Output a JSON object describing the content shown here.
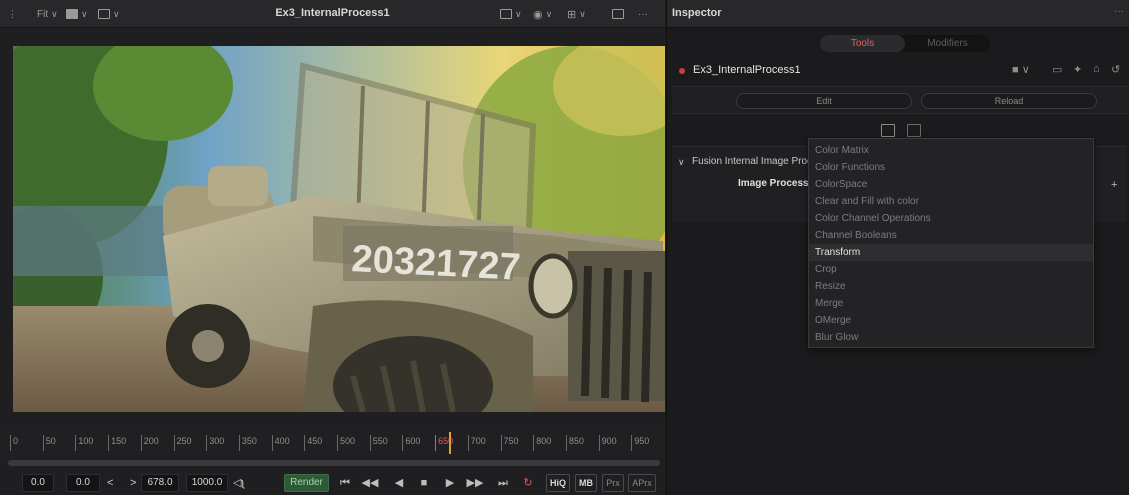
{
  "viewer": {
    "toolbar": {
      "fit_label": "Fit"
    },
    "title": "Ex3_InternalProcess1",
    "plate_number": "20321727",
    "ruler": {
      "ticks": [
        "0",
        "50",
        "100",
        "150",
        "200",
        "250",
        "300",
        "350",
        "400",
        "450",
        "500",
        "550",
        "600",
        "650",
        "700",
        "750",
        "800",
        "850",
        "900",
        "950"
      ]
    },
    "transport": {
      "start": "0.0",
      "current": "0.0",
      "prev": "<",
      "next": ">",
      "end": "678.0",
      "global_end": "1000.0",
      "render_label": "Render",
      "tags": [
        "HiQ",
        "MB",
        "Prx",
        "APrx"
      ]
    }
  },
  "inspector": {
    "title": "Inspector",
    "more": "···",
    "tabs": {
      "tools": "Tools",
      "modifiers": "Modifiers"
    },
    "node_name": "Ex3_InternalProcess1",
    "edit_label": "Edit",
    "reload_label": "Reload",
    "section_title": "Fusion Internal Image Proce",
    "param_label": "Image Process",
    "add_symbol": "+",
    "dropdown_items": [
      "Color Matrix",
      "Color Functions",
      "ColorSpace",
      "Clear and Fill with color",
      "Color Channel Operations",
      "Channel Booleans",
      "Transform",
      "Crop",
      "Resize",
      "Merge",
      "OMerge",
      "Blur Glow"
    ],
    "dropdown_selected": "Transform"
  },
  "colors": {
    "accent_red": "#e06060",
    "node_dot": "#d03c3c",
    "render_green": "#2f5a37",
    "playhead": "#e0a03a"
  }
}
